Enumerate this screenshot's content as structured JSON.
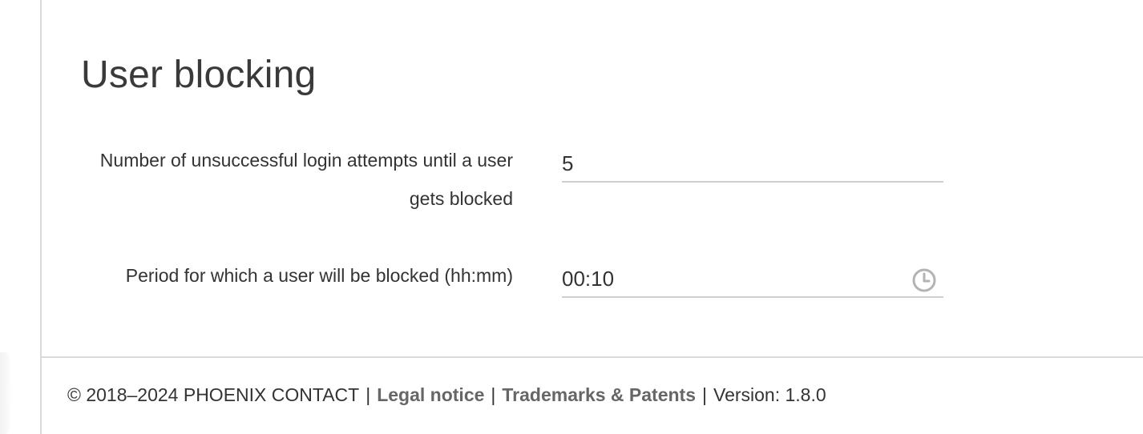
{
  "section": {
    "title": "User blocking"
  },
  "fields": {
    "login_attempts": {
      "label": "Number of unsuccessful login attempts until a user gets blocked",
      "value": "5"
    },
    "block_period": {
      "label": "Period for which a user will be blocked (hh:mm)",
      "value": "00:10",
      "icon": "clock-icon"
    }
  },
  "footer": {
    "copyright": "© 2018–2024 PHOENIX CONTACT",
    "separator": "|",
    "legal_notice": "Legal notice",
    "trademarks": "Trademarks & Patents",
    "version": "Version: 1.8.0"
  },
  "colors": {
    "rule": "#d9d9d9",
    "text": "#333333",
    "link": "#666666",
    "icon": "#b3b3b3"
  }
}
